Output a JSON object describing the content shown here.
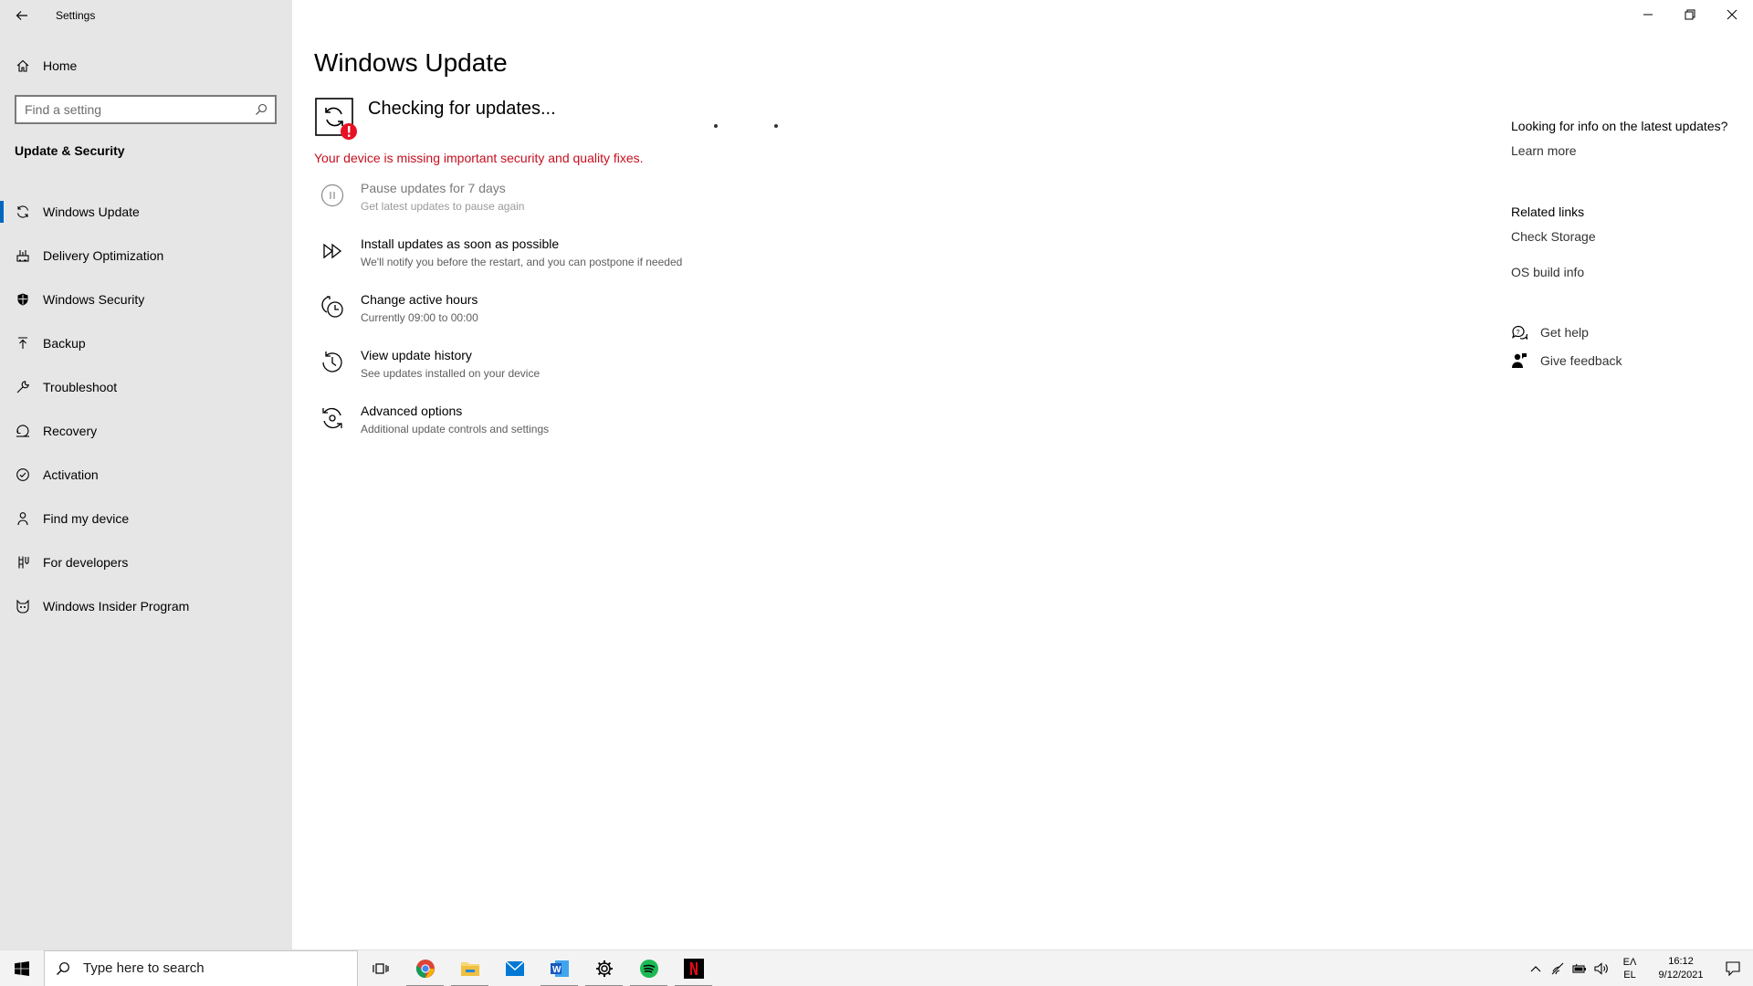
{
  "window": {
    "title": "Settings",
    "controls": [
      "minimize-icon",
      "restore-icon",
      "close-icon"
    ]
  },
  "sidebar": {
    "home_label": "Home",
    "search_placeholder": "Find a setting",
    "section_title": "Update & Security",
    "items": [
      {
        "label": "Windows Update",
        "icon": "sync-icon",
        "active": true
      },
      {
        "label": "Delivery Optimization",
        "icon": "delivery-optimization-icon",
        "active": false
      },
      {
        "label": "Windows Security",
        "icon": "shield-icon",
        "active": false
      },
      {
        "label": "Backup",
        "icon": "backup-arrow-icon",
        "active": false
      },
      {
        "label": "Troubleshoot",
        "icon": "wrench-icon",
        "active": false
      },
      {
        "label": "Recovery",
        "icon": "recovery-icon",
        "active": false
      },
      {
        "label": "Activation",
        "icon": "check-circle-icon",
        "active": false
      },
      {
        "label": "Find my device",
        "icon": "person-pin-icon",
        "active": false
      },
      {
        "label": "For developers",
        "icon": "developer-tools-icon",
        "active": false
      },
      {
        "label": "Windows Insider Program",
        "icon": "insider-cat-icon",
        "active": false
      }
    ]
  },
  "main": {
    "title": "Windows Update",
    "status": "Checking for updates...",
    "warning": "Your device is missing important security and quality fixes.",
    "warning_color": "#c50f1f",
    "options": [
      {
        "title": "Pause updates for 7 days",
        "subtitle": "Get latest updates to pause again",
        "icon": "pause-icon",
        "enabled": false
      },
      {
        "title": "Install updates as soon as possible",
        "subtitle": "We'll notify you before the restart, and you can postpone if needed",
        "icon": "fast-forward-icon",
        "enabled": true
      },
      {
        "title": "Change active hours",
        "subtitle": "Currently 09:00 to 00:00",
        "icon": "active-hours-icon",
        "enabled": true
      },
      {
        "title": "View update history",
        "subtitle": "See updates installed on your device",
        "icon": "history-icon",
        "enabled": true
      },
      {
        "title": "Advanced options",
        "subtitle": "Additional update controls and settings",
        "icon": "advanced-sync-icon",
        "enabled": true
      }
    ]
  },
  "right": {
    "info_heading": "Looking for info on the latest updates?",
    "learn_more": "Learn more",
    "related_heading": "Related links",
    "check_storage": "Check Storage",
    "os_build_info": "OS build info",
    "get_help": "Get help",
    "give_feedback": "Give feedback"
  },
  "taskbar": {
    "search_placeholder": "Type here to search",
    "apps": [
      "task-view-icon",
      "chrome-icon",
      "file-explorer-icon",
      "mail-icon",
      "word-icon",
      "settings-gear-icon",
      "spotify-icon",
      "netflix-icon"
    ],
    "lang_top": "ΕΛ",
    "lang_bottom": "EL",
    "time": "16:12",
    "date": "9/12/2021"
  },
  "colors": {
    "accent": "#0067c0",
    "sidebar_bg": "#e6e6e6",
    "warning": "#c50f1f",
    "badge_red": "#e81123"
  }
}
